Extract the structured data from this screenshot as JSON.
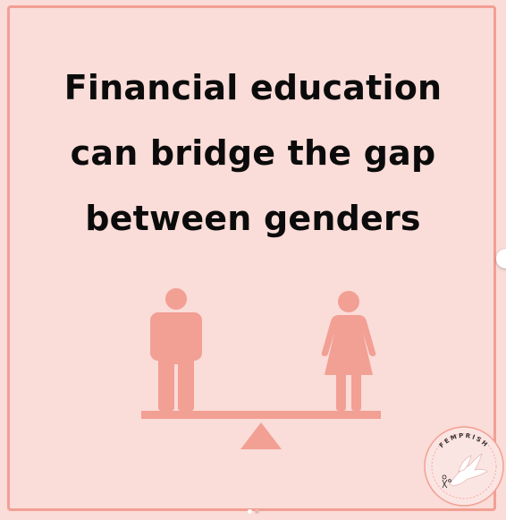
{
  "post": {
    "headline_lines": [
      "Financial education",
      "can bridge the gap",
      "between genders"
    ]
  },
  "logo": {
    "text": "FEMPRISH"
  },
  "carousel": {
    "total_slides": 2,
    "current_slide": 1
  },
  "colors": {
    "background": "#fadcd8",
    "frame": "#f29f94",
    "figure": "#f29f94",
    "headline": "#0b0b0b"
  },
  "icons": [
    "male-figure-icon",
    "female-figure-icon",
    "balance-scale-icon",
    "bird-icon",
    "next-arrow-icon"
  ]
}
